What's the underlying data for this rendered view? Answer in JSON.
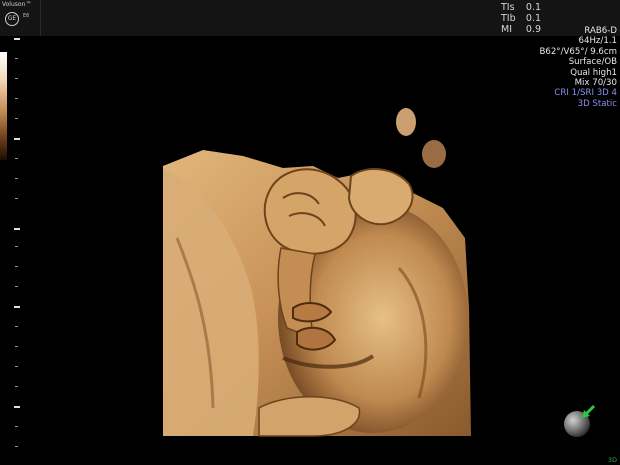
{
  "header": {
    "brand": "Voluson™",
    "logo_text": "GE",
    "model": "E6"
  },
  "safety": [
    {
      "label": "TIs",
      "value": "0.1"
    },
    {
      "label": "TIb",
      "value": "0.1"
    },
    {
      "label": "MI",
      "value": "0.9"
    }
  ],
  "params": {
    "lines": [
      "RAB6-D",
      "64Hz/1.1",
      "B62°/V65°/ 9.6cm",
      "Surface/OB",
      "Qual high1",
      "Mix 70/30"
    ],
    "highlight_lines": [
      "CRI 1/SRI 3D 4",
      "3D Static"
    ]
  },
  "icons": {
    "logo": "ge-logo-icon",
    "orientation": "orientation-sphere-icon",
    "arrow": "orientation-arrow-icon"
  },
  "colors": {
    "background": "#000000",
    "tissue_light": "#d9aa6e",
    "tissue_dark": "#4a2a10",
    "arrow_green": "#2ec44a",
    "accent_blue": "#8e8ef0"
  },
  "view_label": "3D"
}
